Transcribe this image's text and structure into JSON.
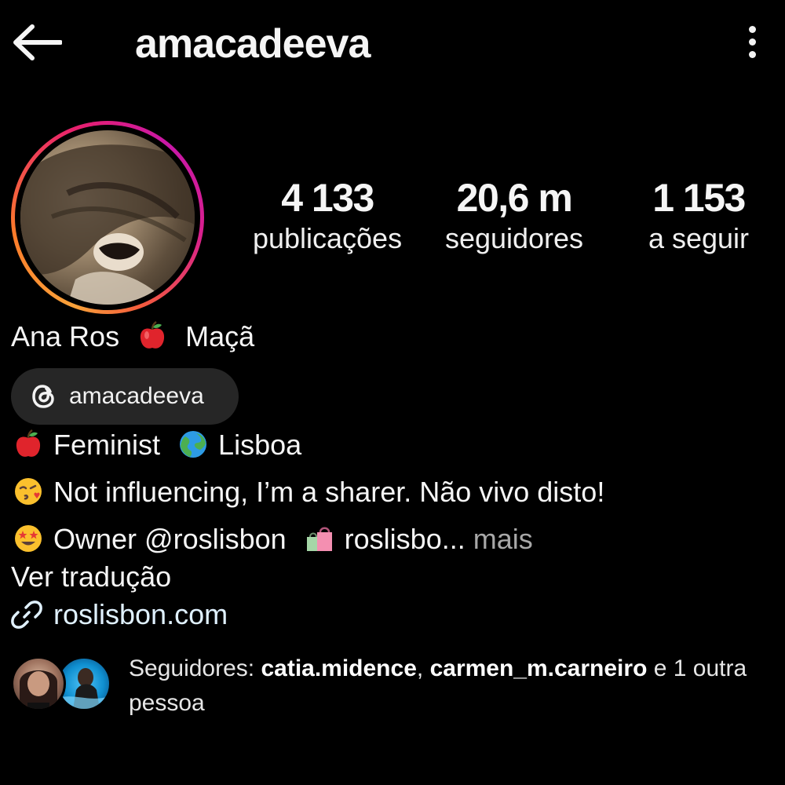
{
  "header": {
    "username": "amacadeeva",
    "back_icon": "arrow-left-icon",
    "more_icon": "more-vertical-icon"
  },
  "profile": {
    "avatar": "profile-photo",
    "story_ring_colors": [
      "#f9a23a",
      "#e8206e",
      "#c818a8"
    ]
  },
  "stats": [
    {
      "value": "4 133",
      "label": "publicações"
    },
    {
      "value": "20,6 m",
      "label": "seguidores"
    },
    {
      "value": "1 153",
      "label": "a seguir"
    }
  ],
  "bio": {
    "name_part1": "Ana Ros",
    "name_part2": "Maçã",
    "threads_handle": "amacadeeva",
    "line1_text1": "Feminist",
    "line1_text2": "Lisboa",
    "line2_text": "Not influencing, I’m a sharer. Não vivo disto!",
    "line3_text1": "Owner @roslisbon",
    "line3_text2": "roslisbo...",
    "line3_more": "mais",
    "translate": "Ver tradução",
    "website": "roslisbon.com"
  },
  "followers": {
    "prefix": "Seguidores:",
    "names": [
      "catia.midence",
      "carmen_m.carneiro"
    ],
    "separator": ",",
    "suffix": "e 1 outra pessoa"
  }
}
